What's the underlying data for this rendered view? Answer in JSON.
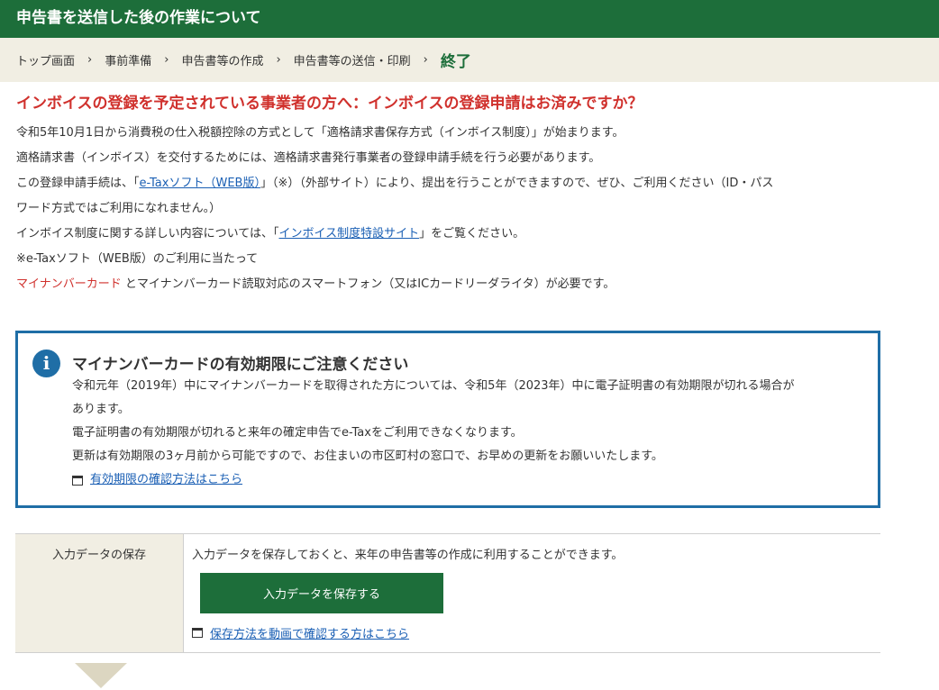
{
  "header": {
    "title": "申告書を送信した後の作業について"
  },
  "breadcrumb": {
    "items": [
      "トップ画面",
      "事前準備",
      "申告書等の作成",
      "申告書等の送信・印刷"
    ],
    "current": "終了",
    "separator": "›"
  },
  "notice": {
    "title": "インボイスの登録を予定されている事業者の方へ：インボイスの登録申請はお済みですか？",
    "line1": "令和5年10月1日から消費税の仕入税額控除の方式として「適格請求書保存方式（インボイス制度）」が始まります。",
    "line2": "適格請求書（インボイス）を交付するためには、適格請求書発行事業者の登録申請手続を行う必要があります。",
    "line3_pre": "この登録申請手続は、「",
    "line3_link": "e-Taxソフト（WEB版）",
    "line3_post": "」（※）（外部サイト）により、提出を行うことができますので、ぜひ、ご利用ください（ID・パス",
    "line4": "ワード方式ではご利用になれません。）",
    "line5_pre": "インボイス制度に関する詳しい内容については、「",
    "line5_link": "インボイス制度特設サイト",
    "line5_post": "」をご覧ください。",
    "line6": "※e-Taxソフト（WEB版）のご利用に当たって",
    "line7_red": "マイナンバーカード",
    "line7_post": " とマイナンバーカード読取対応のスマートフォン（又はICカードリーダライタ）が必要です。"
  },
  "info_box": {
    "icon": "i",
    "title": "マイナンバーカードの有効期限にご注意ください",
    "line1": "令和元年（2019年）中にマイナンバーカードを取得された方については、令和5年（2023年）中に電子証明書の有効期限が切れる場合が",
    "line2": "あります。",
    "line3": "電子証明書の有効期限が切れると来年の確定申告でe-Taxをご利用できなくなります。",
    "line4": "更新は有効期限の3ヶ月前から可能ですので、お住まいの市区町村の窓口で、お早めの更新をお願いいたします。",
    "link": "有効期限の確認方法はこちら"
  },
  "save_section": {
    "label": "入力データの保存",
    "description": "入力データを保存しておくと、来年の申告書等の作成に利用することができます。",
    "button_label": "入力データを保存する",
    "link": "保存方法を動画で確認する方はこちら"
  },
  "colors": {
    "header_green": "#1d6e3a",
    "breadcrumb_bg": "#f1eee3",
    "alert_red": "#d0312d",
    "info_blue": "#1f6ea6",
    "link_blue": "#1a5fb4"
  }
}
